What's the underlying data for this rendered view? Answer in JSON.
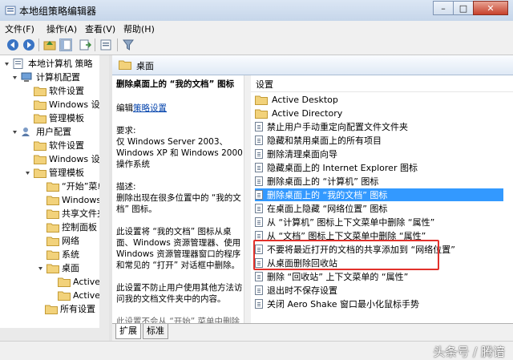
{
  "window": {
    "title": "本地组策略编辑器",
    "minimize": "–",
    "maximize": "□",
    "close": "✕"
  },
  "menu": {
    "file": "文件(F)",
    "action": "操作(A)",
    "view": "查看(V)",
    "help": "帮助(H)"
  },
  "toolbar": {
    "icons": [
      "back-icon",
      "forward-icon",
      "up-folder-icon",
      "show-hide-tree-icon",
      "export-list-icon",
      "properties-icon",
      "filter-icon"
    ]
  },
  "tree": {
    "root": "本地计算机 策略",
    "computer_config": "计算机配置",
    "cc_software": "软件设置",
    "cc_windows": "Windows 设置",
    "cc_admin": "管理模板",
    "user_config": "用户配置",
    "uc_software": "软件设置",
    "uc_windows": "Windows 设置",
    "uc_admin": "管理模板",
    "start_menu": "“开始”菜单",
    "win_components": "Windows 组",
    "shared_folders": "共享文件夹",
    "control_panel": "控制面板",
    "network": "网络",
    "system": "系统",
    "desktop": "桌面",
    "active_desktop": "Active De",
    "active_directory": "Active Di",
    "all_settings": "所有设置"
  },
  "header": {
    "title": "桌面"
  },
  "description": {
    "policy_title": "删除桌面上的 “我的文档” 图标",
    "edit_prefix": "编辑",
    "edit_link": "策略设置",
    "req_label": "要求:",
    "req_line1": "仅 Windows Server 2003、",
    "req_line2": "Windows XP 和 Windows 2000",
    "req_line3": "操作系统",
    "desc_label": "描述:",
    "desc_line1": "删除出现在很多位置中的 “我的文",
    "desc_line2": "档” 图标。",
    "p2_line1": "此设置将 “我的文档” 图标从桌",
    "p2_line2": "面、Windows 资源管理器、使用",
    "p2_line3": "Windows 资源管理器窗口的程序",
    "p2_line4": "和常见的 “打开” 对话框中删除。",
    "p3_line1": "此设置不防止用户使用其他方法访",
    "p3_line2": "问我的文档文件夹中的内容。",
    "p4_line1": "此设置不会从 “开始” 菜单中删除"
  },
  "list": {
    "column": "设置",
    "items": [
      "Active Desktop",
      "Active Directory",
      "禁止用户手动重定向配置文件文件夹",
      "隐藏和禁用桌面上的所有项目",
      "删除清理桌面向导",
      "隐藏桌面上的 Internet Explorer 图标",
      "删除桌面上的 “计算机” 图标",
      "删除桌面上的 “我的文档” 图标",
      "在桌面上隐藏 “网络位置” 图标",
      "从 “计算机” 图标上下文菜单中删除 “属性”",
      "从 “文档” 图标上下文菜单中删除 “属性”",
      "不要将最近打开的文档的共享添加到 “网络位置”",
      "从桌面删除回收站",
      "删除 “回收站” 上下文菜单的 “属性”",
      "退出时不保存设置",
      "关闭 Aero Shake 窗口最小化鼠标手势"
    ]
  },
  "tabs": {
    "extended": "扩展",
    "standard": "标准"
  },
  "watermark": "头条号 / 腾谙"
}
